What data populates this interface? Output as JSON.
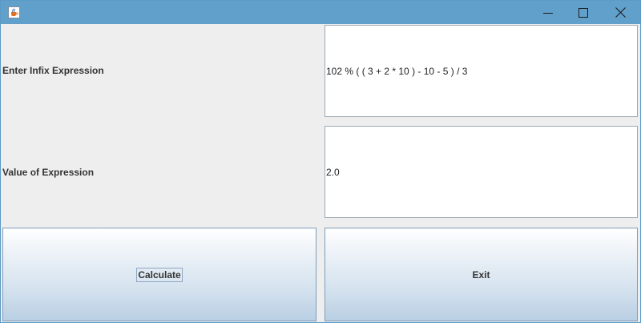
{
  "window": {
    "title": "",
    "icon": "java-cup-icon",
    "controls": {
      "minimize_icon": "minimize-icon",
      "maximize_icon": "maximize-icon",
      "close_icon": "close-icon"
    }
  },
  "form": {
    "infix_label": "Enter Infix Expression",
    "infix_value": "102 % ( ( 3 + 2 * 10 ) - 10 - 5 ) / 3",
    "result_label": "Value of Expression",
    "result_value": "2.0"
  },
  "buttons": {
    "calculate_label": "Calculate",
    "exit_label": "Exit"
  },
  "colors": {
    "titlebar": "#62a0cc",
    "panel": "#eeeeee",
    "field_bg": "#ffffff",
    "button_border": "#7e9cb9"
  }
}
